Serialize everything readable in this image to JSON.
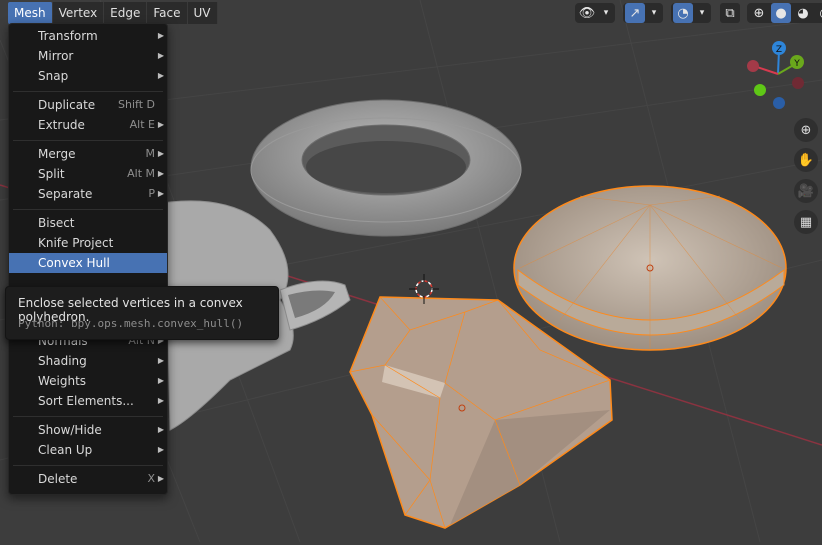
{
  "header": {
    "menus": [
      {
        "label": "Mesh",
        "active": true
      },
      {
        "label": "Vertex",
        "active": false
      },
      {
        "label": "Edge",
        "active": false
      },
      {
        "label": "Face",
        "active": false
      },
      {
        "label": "UV",
        "active": false
      }
    ]
  },
  "mesh_menu": {
    "items": [
      {
        "label": "Transform",
        "shortcut": "",
        "submenu": true
      },
      {
        "label": "Mirror",
        "shortcut": "",
        "submenu": true
      },
      {
        "label": "Snap",
        "shortcut": "",
        "submenu": true
      },
      {
        "label": "Duplicate",
        "shortcut": "Shift D",
        "submenu": false
      },
      {
        "label": "Extrude",
        "shortcut": "Alt E",
        "submenu": true
      },
      {
        "label": "Merge",
        "shortcut": "M",
        "submenu": true
      },
      {
        "label": "Split",
        "shortcut": "Alt M",
        "submenu": true
      },
      {
        "label": "Separate",
        "shortcut": "P",
        "submenu": true
      },
      {
        "label": "Bisect",
        "shortcut": "",
        "submenu": false
      },
      {
        "label": "Knife Project",
        "shortcut": "",
        "submenu": false
      },
      {
        "label": "Convex Hull",
        "shortcut": "",
        "submenu": false,
        "highlighted": true
      },
      {
        "label": "Normals",
        "shortcut": "Alt N",
        "submenu": true
      },
      {
        "label": "Shading",
        "shortcut": "",
        "submenu": true
      },
      {
        "label": "Weights",
        "shortcut": "",
        "submenu": true
      },
      {
        "label": "Sort Elements...",
        "shortcut": "",
        "submenu": true
      },
      {
        "label": "Show/Hide",
        "shortcut": "",
        "submenu": true
      },
      {
        "label": "Clean Up",
        "shortcut": "",
        "submenu": true
      },
      {
        "label": "Delete",
        "shortcut": "X",
        "submenu": true
      }
    ]
  },
  "tooltip": {
    "description": "Enclose selected vertices in a convex polyhedron.",
    "python": "Python: bpy.ops.mesh.convex_hull()"
  },
  "gizmo": {
    "z_label": "Z",
    "y_label": "Y",
    "colors": {
      "x": "#d83a4f",
      "y": "#6aa81c",
      "z": "#2e85d9"
    }
  },
  "colors": {
    "accent": "#4772b3",
    "selection": "#ff8a1a",
    "grid_x_axis": "#8a3340"
  }
}
